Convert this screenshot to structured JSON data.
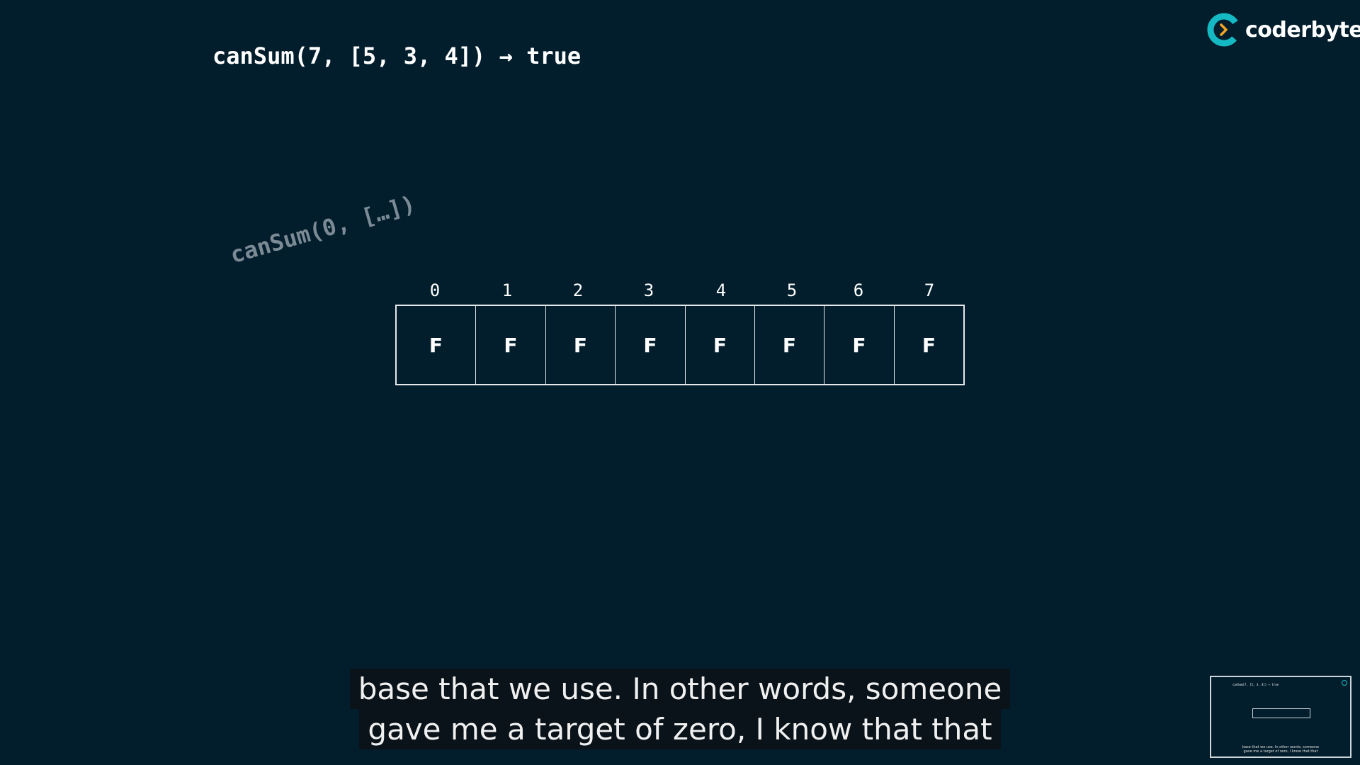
{
  "brand": {
    "name": "coderbyte",
    "logo_icon": "coderbyte-logo-icon",
    "accent_color": "#15b9c4",
    "chevron_color": "#f5a623"
  },
  "slide": {
    "title": "canSum(7, [5, 3, 4]) → true",
    "call_label": "canSum(0, […])",
    "indices": [
      "0",
      "1",
      "2",
      "3",
      "4",
      "5",
      "6",
      "7"
    ],
    "cells": [
      "F",
      "F",
      "F",
      "F",
      "F",
      "F",
      "F",
      "F"
    ]
  },
  "subtitles": {
    "line1": "base that we use. In other words, someone",
    "line2": "gave me a target of zero, I know that that"
  },
  "colors": {
    "background": "#021e2c",
    "text": "#ffffff",
    "muted_label": "#7b8a94",
    "grid_border": "#e6e9ec"
  }
}
